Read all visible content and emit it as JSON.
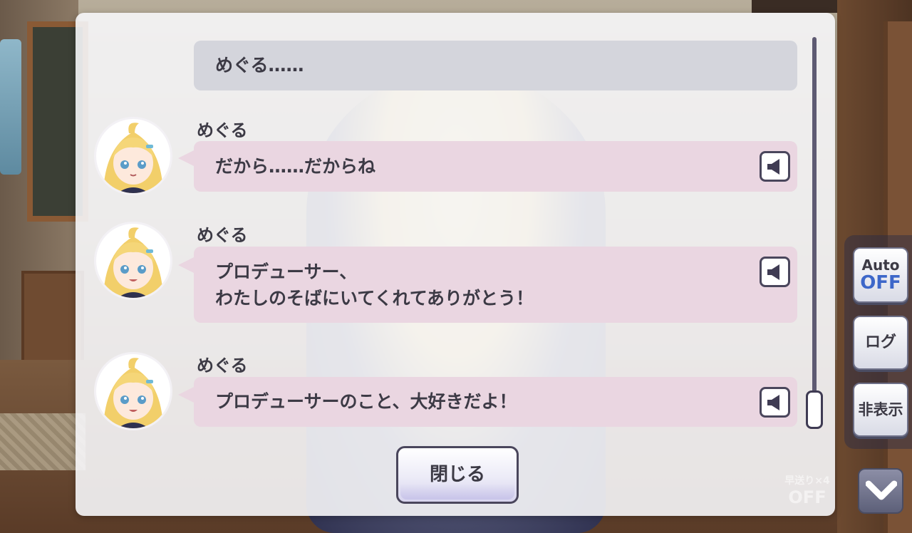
{
  "log": {
    "entries": [
      {
        "type": "narration",
        "text": "めぐる……"
      },
      {
        "type": "speech",
        "speaker": "めぐる",
        "text": "だから……だからね",
        "has_voice": true
      },
      {
        "type": "speech",
        "speaker": "めぐる",
        "text": "プロデューサー、\nわたしのそばにいてくれてありがとう！",
        "has_voice": true
      },
      {
        "type": "speech",
        "speaker": "めぐる",
        "text": "プロデューサーのこと、大好きだよ！",
        "has_voice": true
      }
    ],
    "close_label": "閉じる"
  },
  "controls": {
    "auto_label": "Auto",
    "auto_state": "OFF",
    "log_label": "ログ",
    "hide_label": "非表示",
    "fast_forward_label": "早送り×4",
    "fast_forward_state": "OFF"
  },
  "colors": {
    "speech_bubble": "#ead6e1",
    "narration_bubble": "#d4d5dc",
    "text": "#3c3a45",
    "auto_off": "#3d67c9"
  },
  "icons": {
    "voice": "speaker-icon",
    "down": "chevron-down-icon"
  }
}
